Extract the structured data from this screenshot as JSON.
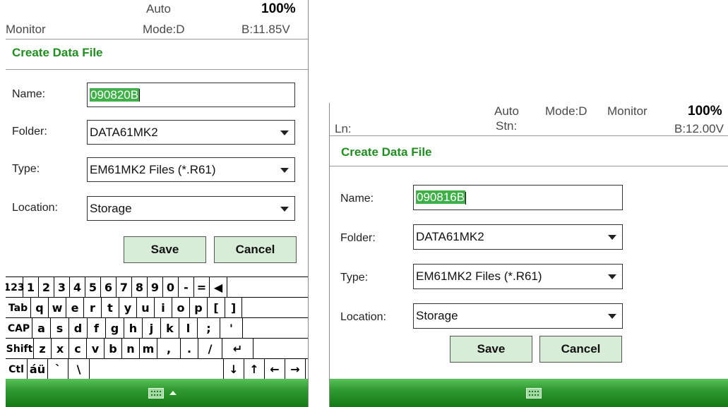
{
  "left_screen": {
    "status": {
      "mode": "Auto",
      "battery": "100%",
      "app": "Monitor",
      "mode_d": "Mode:D",
      "voltage": "B:11.85V"
    },
    "title": "Create Data File",
    "form": {
      "name_label": "Name:",
      "name_value": "090820B",
      "folder_label": "Folder:",
      "folder_value": "DATA61MK2",
      "type_label": "Type:",
      "type_value": "EM61MK2 Files (*.R61)",
      "location_label": "Location:",
      "location_value": "Storage"
    },
    "buttons": {
      "save": "Save",
      "cancel": "Cancel"
    },
    "keyboard": [
      [
        "123",
        "1",
        "2",
        "3",
        "4",
        "5",
        "6",
        "7",
        "8",
        "9",
        "0",
        "-",
        "=",
        "◀"
      ],
      [
        "Tab",
        "q",
        "w",
        "e",
        "r",
        "t",
        "y",
        "u",
        "i",
        "o",
        "p",
        "[",
        "]"
      ],
      [
        "CAP",
        "a",
        "s",
        "d",
        "f",
        "g",
        "h",
        "j",
        "k",
        "l",
        ";",
        "'"
      ],
      [
        "Shift",
        "z",
        "x",
        "c",
        "v",
        "b",
        "n",
        "m",
        ",",
        ".",
        "/",
        "↵"
      ],
      [
        "Ctl",
        "áü",
        "`",
        "\\",
        "",
        "↓",
        "↑",
        "←",
        "→"
      ]
    ]
  },
  "right_screen": {
    "status": {
      "mode": "Auto",
      "mode_d": "Mode:D",
      "app": "Monitor",
      "battery": "100%",
      "ln": "Ln:",
      "stn": "Stn:",
      "voltage": "B:12.00V"
    },
    "title": "Create Data File",
    "form": {
      "name_label": "Name:",
      "name_value": "090816B",
      "folder_label": "Folder:",
      "folder_value": "DATA61MK2",
      "type_label": "Type:",
      "type_value": "EM61MK2 Files (*.R61)",
      "location_label": "Location:",
      "location_value": "Storage"
    },
    "buttons": {
      "save": "Save",
      "cancel": "Cancel"
    }
  },
  "icons": {
    "keyboard": "keyboard-icon",
    "dropdown": "chevron-down-icon",
    "menu_up": "arrow-up-icon"
  },
  "colors": {
    "title_green": "#1f8f1f",
    "button_bg": "#d8edd8",
    "selection": "#3fb048",
    "taskbar": "#2f9a2f"
  }
}
